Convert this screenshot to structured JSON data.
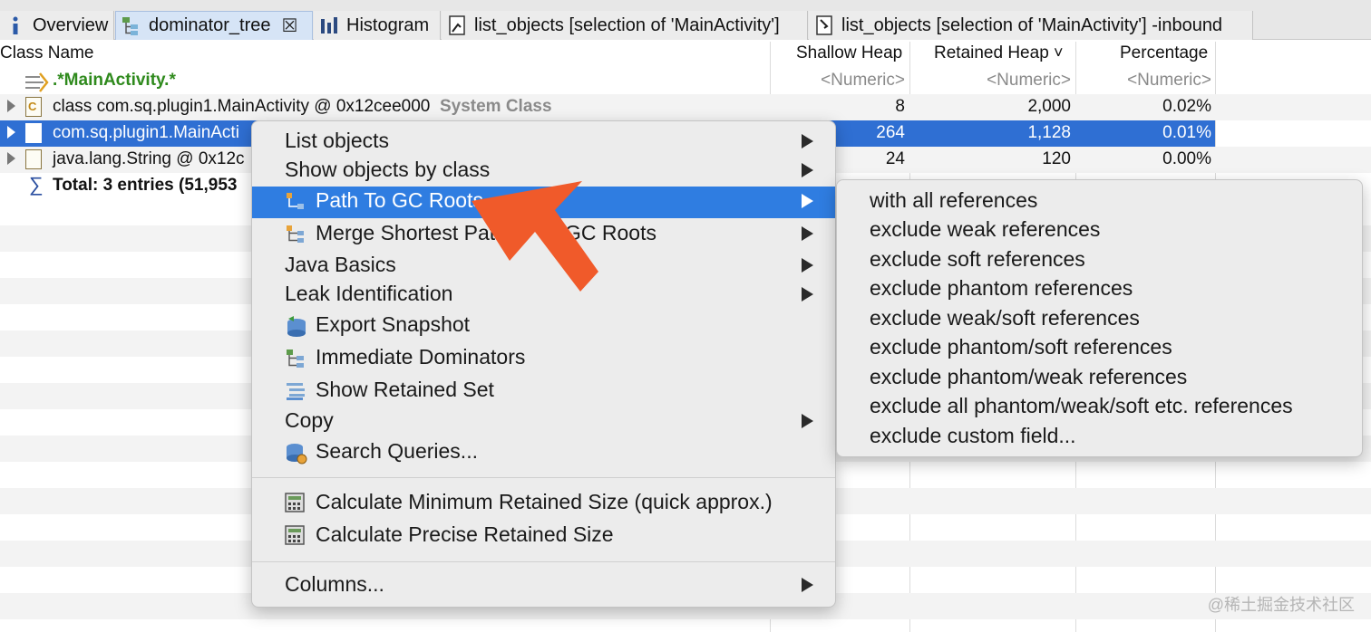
{
  "tabs": [
    {
      "label": "Overview",
      "icon": "info-icon"
    },
    {
      "label": "dominator_tree",
      "icon": "tree-icon",
      "close": "☒"
    },
    {
      "label": "Histogram",
      "icon": "histogram-icon"
    },
    {
      "label": "list_objects  [selection of 'MainActivity']",
      "icon": "list-icon"
    },
    {
      "label": "list_objects  [selection of 'MainActivity'] -inbound",
      "icon": "list-icon"
    }
  ],
  "columns": {
    "class_name": "Class Name",
    "shallow_heap": "Shallow Heap",
    "retained_heap": "Retained Heap",
    "retained_sort": "˅",
    "percentage": "Percentage"
  },
  "filter_row": {
    "regex": ".*MainActivity.*",
    "shallow": "<Numeric>",
    "retained": "<Numeric>",
    "percentage": "<Numeric>"
  },
  "rows": [
    {
      "name": "class com.sq.plugin1.MainActivity @ 0x12cee000",
      "tag": "System Class",
      "shallow": "8",
      "retained": "2,000",
      "percentage": "0.02%"
    },
    {
      "name": "com.sq.plugin1.MainActi",
      "tag": "",
      "shallow": "264",
      "retained": "1,128",
      "percentage": "0.01%"
    },
    {
      "name": "java.lang.String @ 0x12c",
      "tag": "",
      "shallow": "24",
      "retained": "120",
      "percentage": "0.00%"
    }
  ],
  "total_row": {
    "sigma": "∑",
    "label": "Total: 3 entries (51,953"
  },
  "context_menu": {
    "items": [
      {
        "label": "List objects",
        "submenu": true
      },
      {
        "label": "Show objects by class",
        "submenu": true
      },
      {
        "label": "Path To GC Roots",
        "submenu": true,
        "icon": "path-icon",
        "highlighted": true
      },
      {
        "label": "Merge Shortest Pat",
        "label2": "GC Roots",
        "submenu": true,
        "icon": "merge-icon"
      },
      {
        "label": "Java Basics",
        "submenu": true
      },
      {
        "label": "Leak Identification",
        "submenu": true
      },
      {
        "label": "Export Snapshot",
        "icon": "export-icon"
      },
      {
        "label": "Immediate Dominators",
        "icon": "dominators-icon"
      },
      {
        "label": "Show Retained Set",
        "icon": "retained-set-icon"
      },
      {
        "label": "Copy",
        "submenu": true
      },
      {
        "label": "Search Queries...",
        "icon": "search-queries-icon"
      },
      {
        "label": "Calculate Minimum Retained Size (quick approx.)",
        "icon": "calculator-icon"
      },
      {
        "label": "Calculate Precise Retained Size",
        "icon": "calculator-icon"
      },
      {
        "label": "Columns...",
        "submenu": true
      }
    ]
  },
  "submenu": {
    "items": [
      "with all references",
      "exclude weak references",
      "exclude soft references",
      "exclude phantom references",
      "exclude weak/soft references",
      "exclude phantom/soft references",
      "exclude phantom/weak references",
      "exclude all phantom/weak/soft etc. references",
      "exclude custom field..."
    ]
  },
  "watermark": "@稀土掘金技术社区",
  "colors": {
    "selection": "#2f6fd3",
    "menu_highlight": "#2f7de1",
    "arrow": "#f05a2a",
    "filter_green": "#2f8a1d"
  }
}
